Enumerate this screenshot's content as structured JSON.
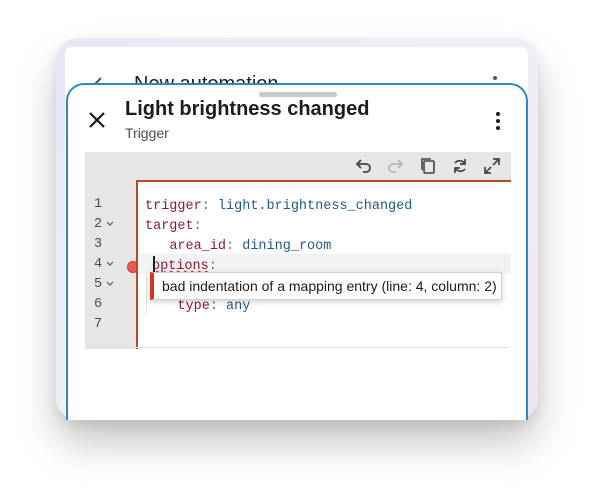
{
  "background_window": {
    "title": "New automation",
    "back_icon": "arrow-left-icon",
    "more_icon": "more-vert-icon"
  },
  "sheet": {
    "title": "Light brightness changed",
    "subtitle": "Trigger",
    "close_icon": "close-icon",
    "more_icon": "more-vert-icon"
  },
  "editor": {
    "toolbar": {
      "buttons": [
        {
          "name": "undo",
          "icon": "undo-icon",
          "enabled": true
        },
        {
          "name": "redo",
          "icon": "redo-icon",
          "enabled": false
        },
        {
          "name": "copy",
          "icon": "copy-icon",
          "enabled": true
        },
        {
          "name": "reformat",
          "icon": "refresh-icon",
          "enabled": true
        },
        {
          "name": "fullscreen",
          "icon": "expand-icon",
          "enabled": true
        }
      ]
    },
    "line_numbers": [
      "1",
      "2",
      "3",
      "4",
      "5",
      "6",
      "7"
    ],
    "lines": [
      {
        "key": "trigger",
        "sep": ": ",
        "value": "light.brightness_changed",
        "indent": ""
      },
      {
        "key": "target",
        "sep": ":",
        "value": "",
        "indent": ""
      },
      {
        "key": "area_id",
        "sep": ": ",
        "value": "dining_room",
        "indent": "   "
      },
      {
        "key": "options",
        "sep": ":",
        "value": "",
        "indent": ""
      },
      {
        "key": "",
        "sep": "",
        "value": "",
        "indent": ""
      },
      {
        "key": "type",
        "sep": ": ",
        "value": "any",
        "indent": "    "
      },
      {
        "key": "",
        "sep": "",
        "value": "",
        "indent": ""
      }
    ],
    "lint_error": "bad indentation of a mapping entry (line: 4, column: 2)"
  },
  "colors": {
    "accent": "#2e86c6",
    "error": "#d4361f",
    "key": "#8b1a3a",
    "value": "#1e5a8a"
  }
}
